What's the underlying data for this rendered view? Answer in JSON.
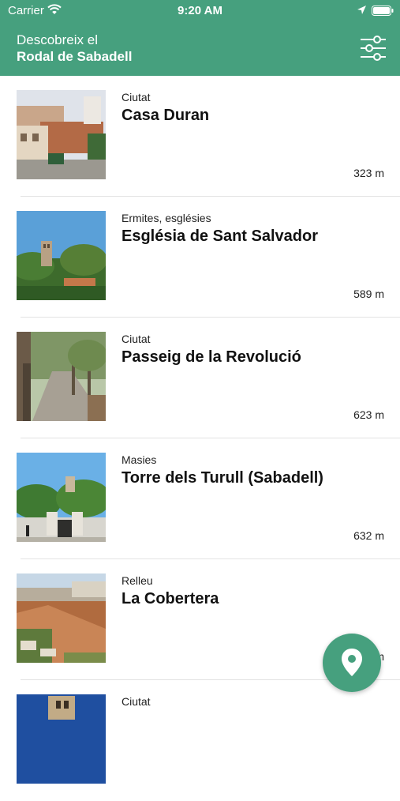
{
  "status_bar": {
    "carrier": "Carrier",
    "time": "9:20 AM"
  },
  "header": {
    "title_line1": "Descobreix el",
    "title_line2": "Rodal de Sabadell",
    "filter_icon": "sliders-icon"
  },
  "places": [
    {
      "category": "Ciutat",
      "name": "Casa Duran",
      "distance": "323 m"
    },
    {
      "category": "Ermites, esglésies",
      "name": "Església de Sant Salvador",
      "distance": "589 m"
    },
    {
      "category": "Ciutat",
      "name": "Passeig de la Revolució",
      "distance": "623 m"
    },
    {
      "category": "Masies",
      "name": "Torre dels Turull (Sabadell)",
      "distance": "632 m"
    },
    {
      "category": "Relleu",
      "name": "La Cobertera",
      "distance": "m"
    },
    {
      "category": "Ciutat",
      "name": "",
      "distance": ""
    }
  ],
  "map_button": {
    "icon": "map-pin-icon"
  },
  "colors": {
    "brand_green": "#46a07e"
  }
}
